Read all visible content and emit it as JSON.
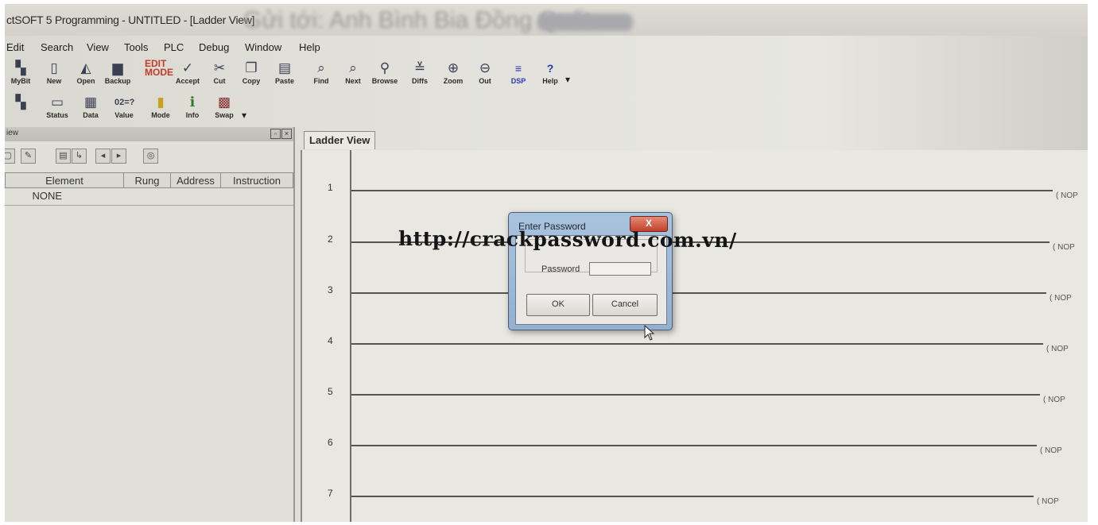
{
  "window": {
    "title": "ctSOFT 5 Programming - UNTITLED - [Ladder View]",
    "title_overlay_blurred": "Gửi tới: Anh Bình Bia Đồng Quất"
  },
  "menu": [
    "Edit",
    "Search",
    "View",
    "Tools",
    "PLC",
    "Debug",
    "Window",
    "Help"
  ],
  "toolbar1": [
    {
      "label": "MyBit",
      "icon": "mybit-icon"
    },
    {
      "label": "New",
      "icon": "new-file-icon"
    },
    {
      "label": "Open",
      "icon": "open-folder-icon"
    },
    {
      "label": "Backup",
      "icon": "backup-icon"
    },
    {
      "label": "EDIT MODE",
      "icon": "edit-mode-icon"
    },
    {
      "label": "Accept",
      "icon": "accept-icon"
    },
    {
      "label": "Cut",
      "icon": "cut-icon"
    },
    {
      "label": "Copy",
      "icon": "copy-icon"
    },
    {
      "label": "Paste",
      "icon": "paste-icon"
    },
    {
      "label": "Find",
      "icon": "find-icon"
    },
    {
      "label": "Next",
      "icon": "next-icon"
    },
    {
      "label": "Browse",
      "icon": "browse-icon"
    },
    {
      "label": "Diffs",
      "icon": "diffs-icon"
    },
    {
      "label": "Zoom",
      "icon": "zoom-icon"
    },
    {
      "label": "Out",
      "icon": "zoom-out-icon"
    },
    {
      "label": "DSP",
      "icon": "dsp-icon"
    },
    {
      "label": "Help",
      "icon": "help-icon"
    }
  ],
  "toolbar2": [
    {
      "label": "",
      "icon": "mybit-icon"
    },
    {
      "label": "Status",
      "icon": "status-icon"
    },
    {
      "label": "Data",
      "icon": "data-icon"
    },
    {
      "label": "Value",
      "icon": "value-icon",
      "glyph": "02=?"
    },
    {
      "label": "Mode",
      "icon": "mode-icon"
    },
    {
      "label": "Info",
      "icon": "info-icon"
    },
    {
      "label": "Swap",
      "icon": "swap-icon"
    }
  ],
  "left_pane": {
    "caption": "iew",
    "columns": [
      "Element",
      "Rung",
      "Address",
      "Instruction"
    ],
    "rows": [
      [
        "NONE",
        "",
        "",
        ""
      ]
    ]
  },
  "ladder": {
    "tab_label": "Ladder View",
    "rungs": [
      {
        "number": "1",
        "coil": "NOP"
      },
      {
        "number": "2",
        "coil": "NOP"
      },
      {
        "number": "3",
        "coil": "NOP"
      },
      {
        "number": "4",
        "coil": "NOP"
      },
      {
        "number": "5",
        "coil": "NOP"
      },
      {
        "number": "6",
        "coil": "NOP"
      },
      {
        "number": "7",
        "coil": "NOP"
      }
    ]
  },
  "watermark": "http://crackpassword.com.vn/",
  "dialog": {
    "title": "Enter Password",
    "close_glyph": "X",
    "field_label": "Password",
    "field_value": "",
    "ok_label": "OK",
    "cancel_label": "Cancel"
  },
  "colors": {
    "dialog_frame": "#a9c3de",
    "close_button": "#c1412b",
    "screen_bg": "#e2e1db"
  }
}
